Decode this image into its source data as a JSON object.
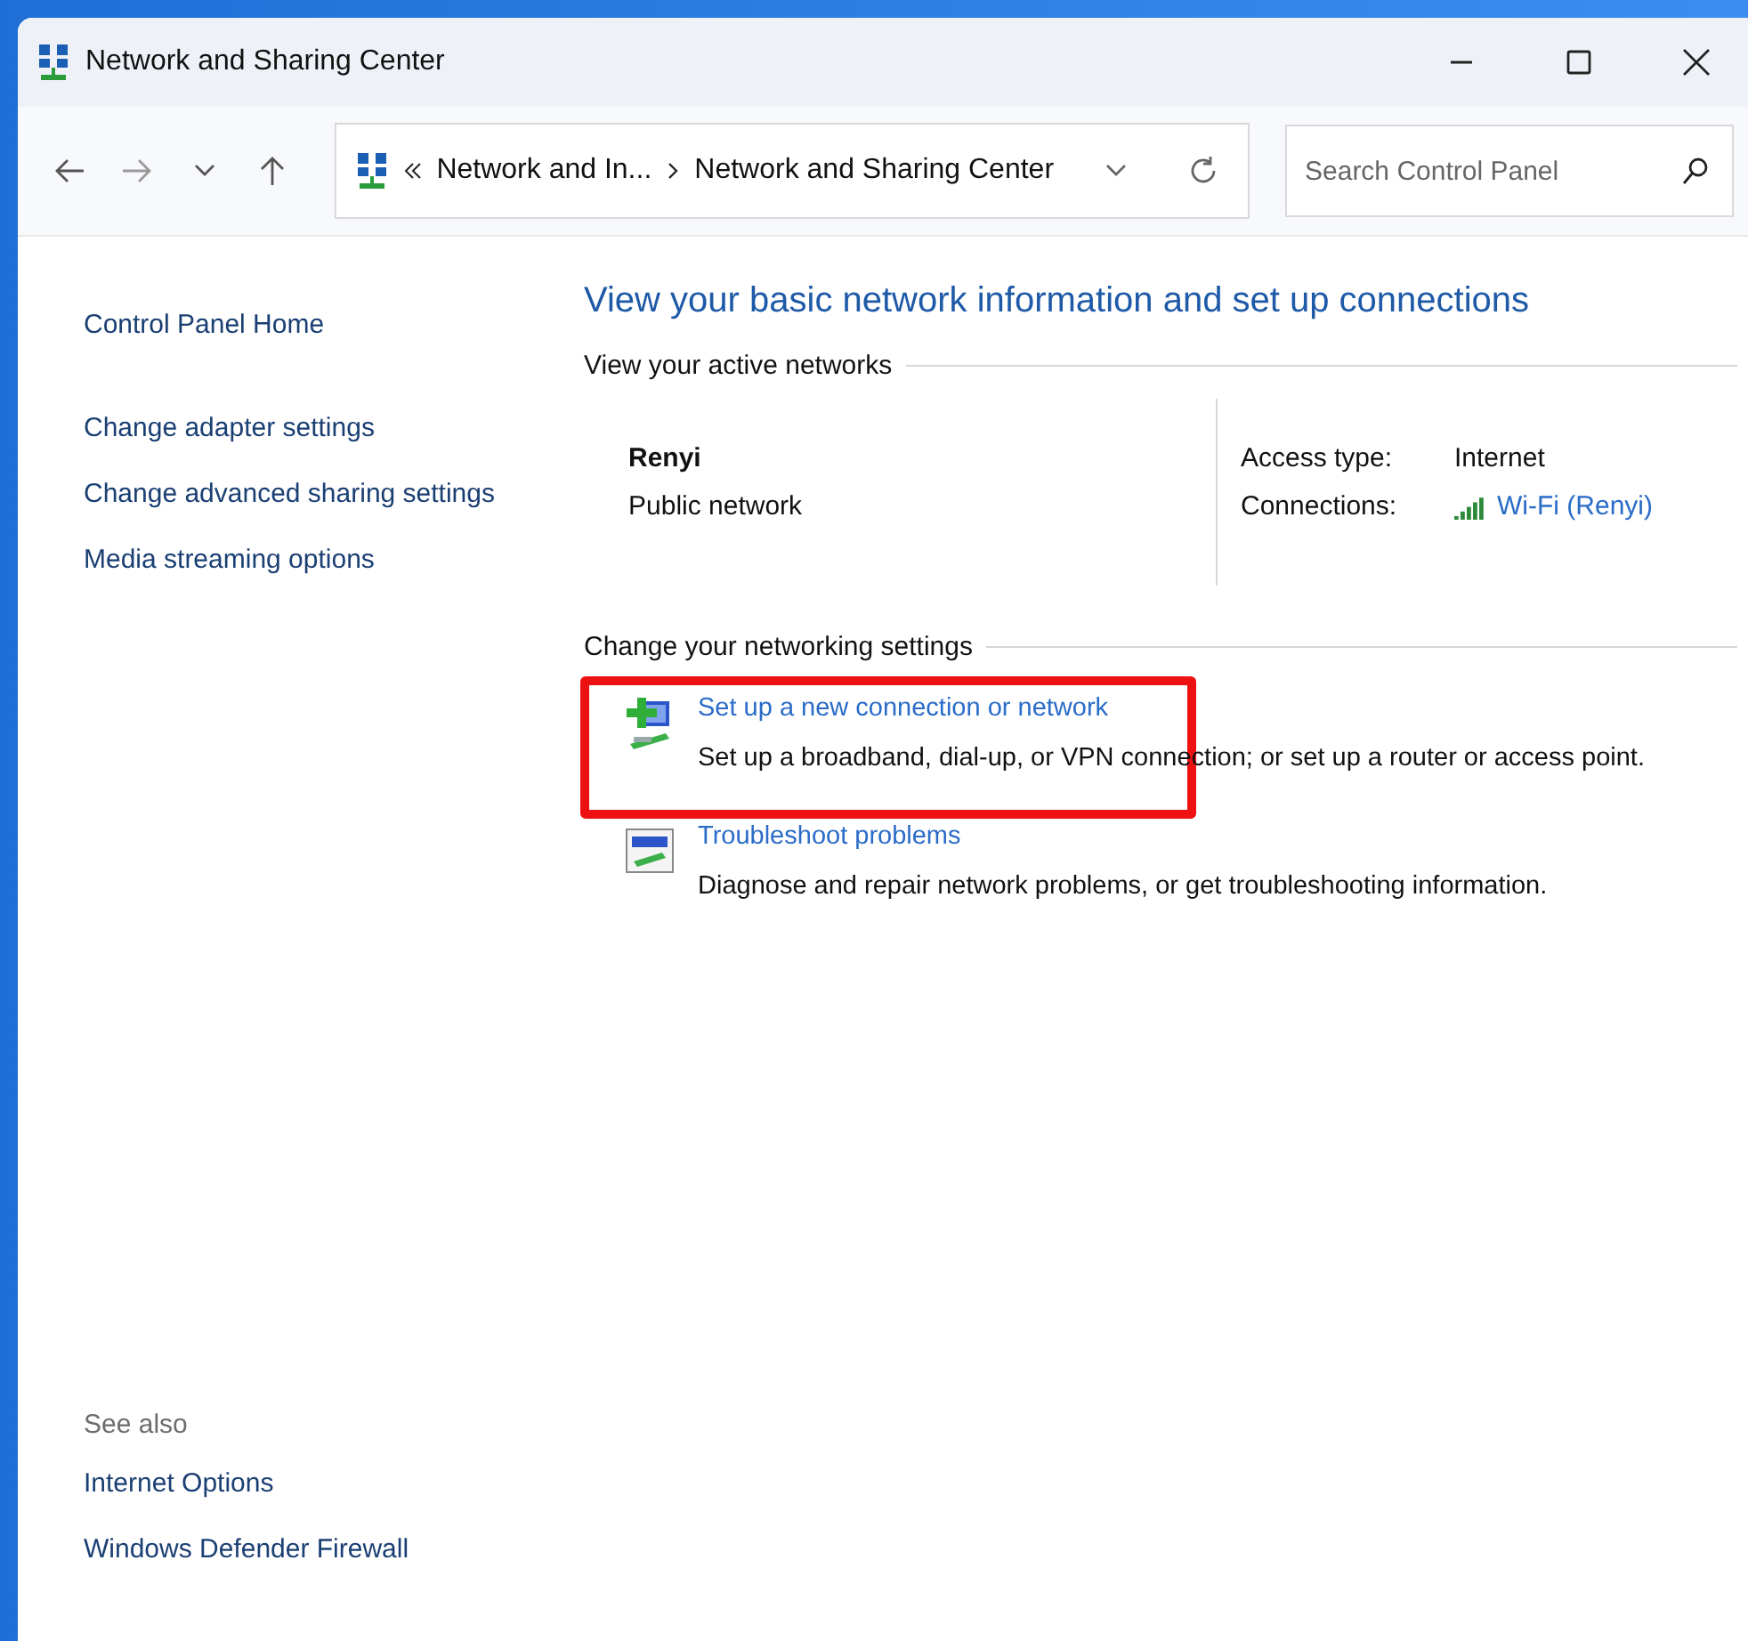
{
  "window": {
    "title": "Network and Sharing Center"
  },
  "address": {
    "crumbs": [
      "Network and In...",
      "Network and Sharing Center"
    ]
  },
  "search": {
    "placeholder": "Search Control Panel"
  },
  "sidebar": {
    "items": [
      "Control Panel Home",
      "Change adapter settings",
      "Change advanced sharing settings",
      "Media streaming options"
    ],
    "see_also_heading": "See also",
    "see_also": [
      "Internet Options",
      "Windows Defender Firewall"
    ]
  },
  "main": {
    "heading": "View your basic network information and set up connections",
    "active_section": "View your active networks",
    "network": {
      "name": "Renyi",
      "category": "Public network",
      "access_label": "Access type:",
      "access_value": "Internet",
      "connections_label": "Connections:",
      "connection_link": "Wi-Fi (Renyi)"
    },
    "settings_section": "Change your networking settings",
    "tasks": [
      {
        "kind": "new-connection",
        "title": "Set up a new connection or network",
        "description": "Set up a broadband, dial-up, or VPN connection; or set up a router or access point.",
        "highlighted": true
      },
      {
        "kind": "troubleshoot",
        "title": "Troubleshoot problems",
        "description": "Diagnose and repair network problems, or get troubleshooting information.",
        "highlighted": false
      }
    ]
  }
}
